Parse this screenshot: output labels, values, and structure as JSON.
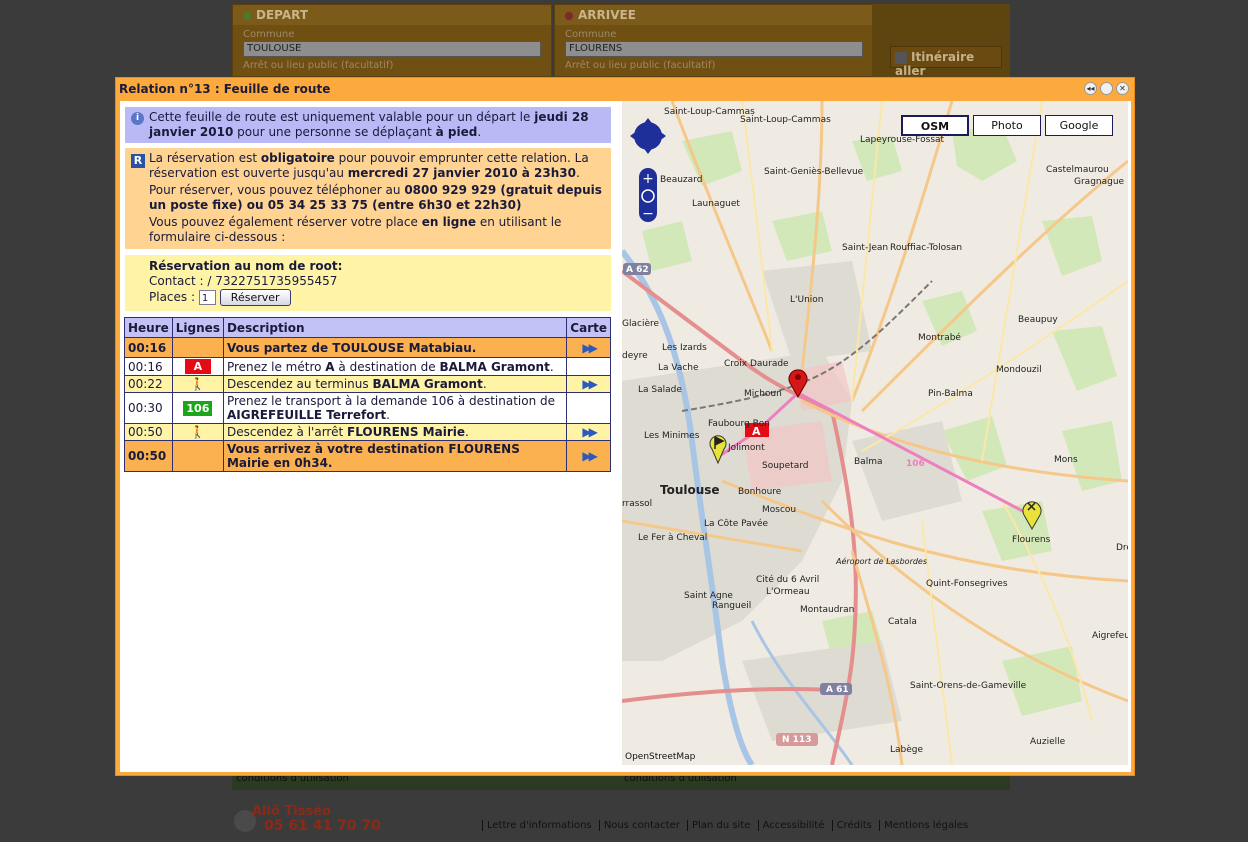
{
  "background": {
    "depart_title": "DEPART",
    "arrivee_title": "ARRIVEE",
    "commune_label": "Commune",
    "depart_commune": "TOULOUSE",
    "arrivee_commune": "FLOURENS",
    "arret_label": "Arrêt ou lieu public (facultatif)",
    "itineraire_button": "Itinéraire aller",
    "strip_left": "conditions d'utilisation",
    "strip_right": "conditions d'utilisation",
    "phone_title": "Allô Tisséo",
    "phone_number": "05 61 41 70 70",
    "footer_links": [
      "Lettre d'informations",
      "Nous contacter",
      "Plan du site",
      "Accessibilité",
      "Crédits",
      "Mentions légales"
    ]
  },
  "modal": {
    "title": "Relation n°13 : Feuille de route",
    "info": {
      "t1": "Cette feuille de route est uniquement valable pour un départ le ",
      "b1": "jeudi 28 janvier 2010",
      "t2": " pour une personne se déplaçant ",
      "b2": "à pied",
      "t3": "."
    },
    "resa": {
      "p1a": "La réservation est ",
      "p1b": "obligatoire",
      "p1c": " pour pouvoir emprunter cette relation. La réservation est ouverte jusqu'au ",
      "p1d": "mercredi 27 janvier 2010 à 23h30",
      "p1e": ".",
      "p2a": "Pour réserver, vous pouvez téléphoner au ",
      "p2b": "0800 929 929 (gratuit depuis un poste fixe) ou 05 34 25 33 75 (entre 6h30 et 22h30)",
      "p3a": "Vous pouvez également réserver votre place ",
      "p3b": "en ligne",
      "p3c": " en utilisant le formulaire ci-dessous :"
    },
    "form": {
      "title": "Réservation au nom de root:",
      "contact": "Contact : / 7322751735955457",
      "places_label": "Places :",
      "places_value": "1",
      "reserve_button": "Réserver"
    },
    "table": {
      "headers": [
        "Heure",
        "Lignes",
        "Description",
        "Carte"
      ],
      "rows": [
        {
          "heure": "00:16",
          "desc_a": "Vous partez de TOULOUSE Matabiau.",
          "desc_b": ""
        },
        {
          "heure": "00:16",
          "ligne": "A",
          "desc_a": "Prenez le métro ",
          "desc_b": "A",
          "desc_c": " à destination de ",
          "desc_d": "BALMA Gramont",
          "desc_e": "."
        },
        {
          "heure": "00:22",
          "desc_a": "Descendez au terminus ",
          "desc_b": "BALMA Gramont",
          "desc_c": "."
        },
        {
          "heure": "00:30",
          "ligne": "106",
          "desc_a": "Prenez le transport à la demande 106 à destination de ",
          "desc_b": "AIGREFEUILLE Terrefort",
          "desc_c": "."
        },
        {
          "heure": "00:50",
          "desc_a": "Descendez à l'arrêt ",
          "desc_b": "FLOURENS Mairie",
          "desc_c": "."
        },
        {
          "heure": "00:50",
          "desc_a": "Vous arrivez à votre destination FLOURENS Mairie en 0h34."
        }
      ]
    },
    "map": {
      "layers": [
        "OSM",
        "Photo",
        "Google"
      ],
      "credit": "OpenStreetMap",
      "labels": {
        "l1": "Gragnague",
        "l2": "Saint-Loup-Cammas",
        "l3": "Lapeyrouse-Fossat",
        "l4": "Saint-Geniès-Bellevue",
        "l5": "Castelmaurou",
        "l6": "Launaguet",
        "l7": "Saint-Jean",
        "l8": "Rouffiac-Tolosan",
        "l9": "L'Union",
        "l10": "Beaupuy",
        "l11": "Montrabé",
        "l12": "Mondouzil",
        "l13": "Pin-Balma",
        "l14": "Croix Daurade",
        "l15": "Michoun",
        "l16": "Les Izards",
        "l17": "La Vache",
        "l18": "La Salade",
        "l19": "Faubourg Bon",
        "l20": "Les Minimes",
        "l21": "Jolimont",
        "l22": "Soupetard",
        "l23": "Balma",
        "l24": "Mons",
        "l25": "Flourens",
        "l26": "Toulouse",
        "l27": "Bonhoure",
        "l28": "Moscou",
        "l29": "La Côte Pavée",
        "l30": "Le Fer à Cheval",
        "l31": "Aéroport de Lasbordes",
        "l32": "Quint-Fonsegrives",
        "l33": "Cité du 6 Avril",
        "l34": "L'Ormeau",
        "l35": "Saint Agne",
        "l36": "Rangueil",
        "l37": "Montaudran",
        "l38": "Catala",
        "l39": "Aigrefeuille",
        "l40": "Saint-Orens-de-Gameville",
        "l41": "Labège",
        "l42": "Auzielle",
        "l43": "Beauzard",
        "l44": "Glacière",
        "l45": "deyre",
        "l46": "rrassol",
        "l47": "Dre",
        "r1": "A 62",
        "r2": "A 61",
        "r3": "N 113",
        "r4": "106",
        "r5": "A"
      }
    }
  }
}
